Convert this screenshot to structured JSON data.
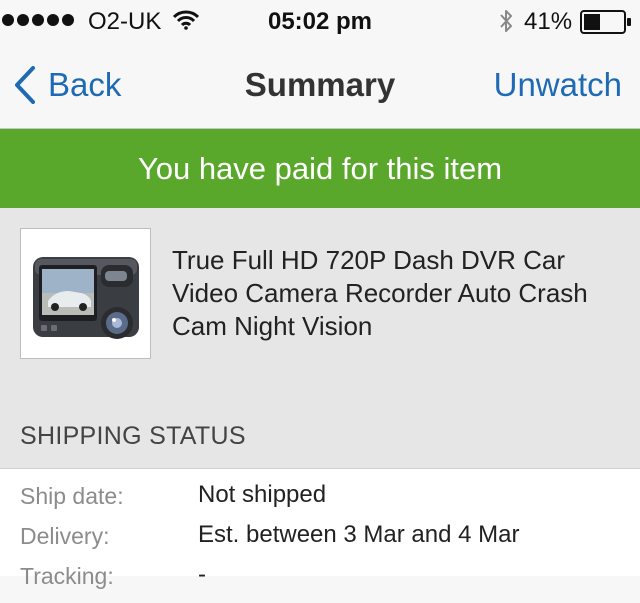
{
  "status_bar": {
    "carrier": "O2-UK",
    "time": "05:02 pm",
    "battery": "41%",
    "battery_level": 0.41,
    "signal_bars": 5,
    "icons": [
      "wifi-icon",
      "bluetooth-icon",
      "battery-icon"
    ]
  },
  "nav": {
    "back_label": "Back",
    "title": "Summary",
    "unwatch_label": "Unwatch"
  },
  "banner": {
    "text": "You have paid for this item",
    "color": "#59a82b"
  },
  "item": {
    "title": "True Full HD 720P Dash DVR Car Video Camera Recorder Auto Crash Cam Night Vision",
    "image": "dash-camera-photo"
  },
  "shipping": {
    "header": "SHIPPING STATUS",
    "rows": [
      {
        "label": "Ship date:",
        "value": "Not shipped"
      },
      {
        "label": "Delivery:",
        "value": "Est. between 3 Mar and 4 Mar"
      },
      {
        "label": "Tracking:",
        "value": "-"
      }
    ]
  },
  "colors": {
    "accent": "#1e6ab5",
    "banner": "#59a82b"
  }
}
